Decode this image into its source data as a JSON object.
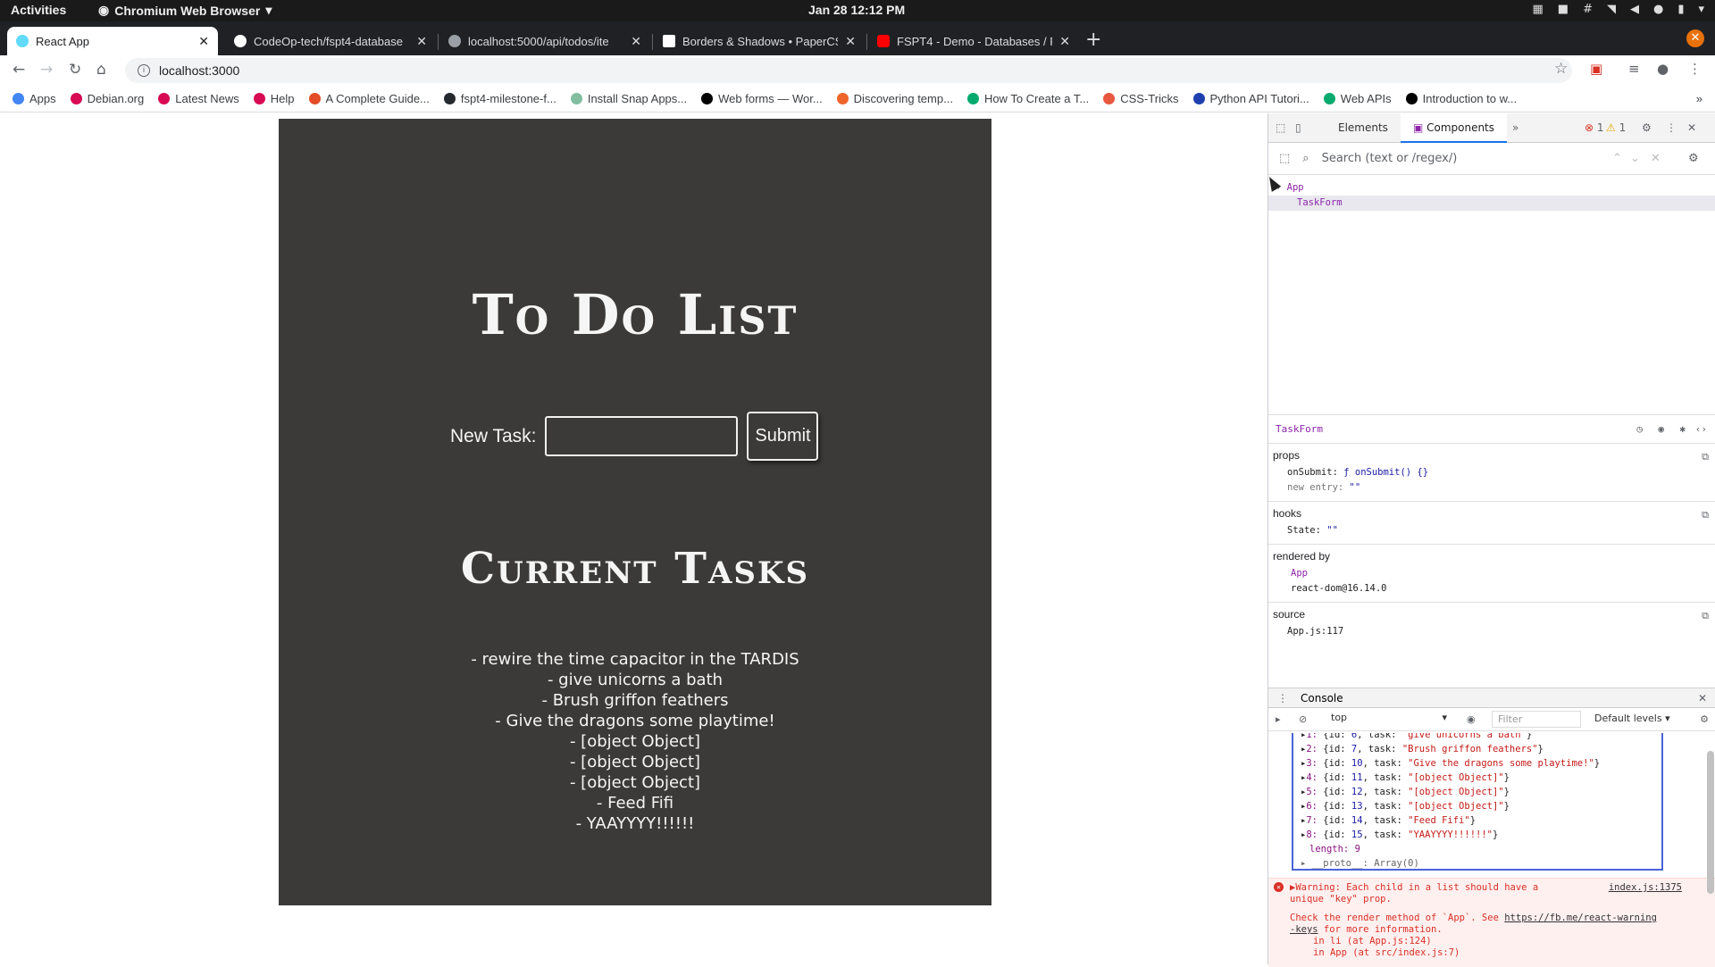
{
  "topbar": {
    "activities": "Activities",
    "app_menu": "Chromium Web Browser",
    "clock": "Jan 28  12:12 PM"
  },
  "tabs": [
    {
      "label": "React App",
      "active": true,
      "icon": "react-icon",
      "color": "#61dafb"
    },
    {
      "label": "CodeOp-tech/fspt4-database",
      "active": false,
      "icon": "github-icon",
      "color": "#ffffff"
    },
    {
      "label": "localhost:5000/api/todos/ite",
      "active": false,
      "icon": "globe-icon",
      "color": "#9aa0a6"
    },
    {
      "label": "Borders & Shadows • PaperCS",
      "active": false,
      "icon": "paper-icon",
      "color": "#ffffff"
    },
    {
      "label": "FSPT4 - Demo - Databases / Fu",
      "active": false,
      "icon": "youtube-icon",
      "color": "#ff0000"
    }
  ],
  "address": {
    "url": "localhost:3000"
  },
  "bookmarks": [
    {
      "label": "Apps",
      "color": "#4285f4"
    },
    {
      "label": "Debian.org",
      "color": "#d70a53"
    },
    {
      "label": "Latest News",
      "color": "#d70a53"
    },
    {
      "label": "Help",
      "color": "#d70a53"
    },
    {
      "label": "A Complete Guide...",
      "color": "#e34c26"
    },
    {
      "label": "fspt4-milestone-f...",
      "color": "#24292e"
    },
    {
      "label": "Install Snap Apps...",
      "color": "#82bea0"
    },
    {
      "label": "Web forms — Wor...",
      "color": "#000000"
    },
    {
      "label": "Discovering temp...",
      "color": "#f06529"
    },
    {
      "label": "How To Create a T...",
      "color": "#04aa6d"
    },
    {
      "label": "CSS-Tricks",
      "color": "#e9573f"
    },
    {
      "label": "Python API Tutori...",
      "color": "#1e40af"
    },
    {
      "label": "Web APIs",
      "color": "#04aa6d"
    },
    {
      "label": "Introduction to w...",
      "color": "#000000"
    }
  ],
  "app": {
    "title": "To Do List",
    "new_task_label": "New Task:",
    "input_value": "",
    "submit_label": "Submit",
    "current_tasks_title": "Current Tasks",
    "tasks": [
      "- rewire the time capacitor in the TARDIS",
      "- give unicorns a bath",
      "- Brush griffon feathers",
      "- Give the dragons some playtime!",
      "- [object Object]",
      "- [object Object]",
      "- [object Object]",
      "- Feed Fifi",
      "- YAAYYYY!!!!!!"
    ],
    "bg_color": "#3b3a38"
  },
  "devtools": {
    "tabs": [
      "Elements",
      "Components"
    ],
    "active_tab": "Components",
    "error_count": "1",
    "warning_count": "1",
    "search_placeholder": "Search (text or /regex/)",
    "tree": [
      "App",
      "TaskForm"
    ],
    "inspector": {
      "component": "TaskForm",
      "props_label": "props",
      "props": [
        {
          "key": "onSubmit:",
          "value": "ƒ onSubmit() {}"
        },
        {
          "key": "new entry:",
          "value": "\"\""
        }
      ],
      "hooks_label": "hooks",
      "hooks": [
        {
          "key": "State:",
          "value": "\"\""
        }
      ],
      "rendered_by_label": "rendered by",
      "rendered_by": [
        "App",
        "react-dom@16.14.0"
      ],
      "source_label": "source",
      "source": "App.js:117"
    },
    "console": {
      "title": "Console",
      "context": "top",
      "filter_placeholder": "Filter",
      "levels": "Default levels ▾",
      "entries": [
        {
          "idx": "1:",
          "id": "6",
          "task": "\"give unicorns a bath\""
        },
        {
          "idx": "2:",
          "id": "7",
          "task": "\"Brush griffon feathers\""
        },
        {
          "idx": "3:",
          "id": "10",
          "task": "\"Give the dragons some playtime!\""
        },
        {
          "idx": "4:",
          "id": "11",
          "task": "\"[object Object]\""
        },
        {
          "idx": "5:",
          "id": "12",
          "task": "\"[object Object]\""
        },
        {
          "idx": "6:",
          "id": "13",
          "task": "\"[object Object]\""
        },
        {
          "idx": "7:",
          "id": "14",
          "task": "\"Feed Fifi\""
        },
        {
          "idx": "8:",
          "id": "15",
          "task": "\"YAAYYYY!!!!!!\""
        }
      ],
      "length_line": "length: 9",
      "proto_line": "__proto__: Array(0)",
      "warning": {
        "message_1": "▶Warning: Each child in a list should have a",
        "message_2": "unique \"key\" prop.",
        "source": "index.js:1375",
        "check_line": "Check the render method of `App`. See",
        "link_1": "https://fb.me/react-warning",
        "link_2": "-keys",
        "link_rest": " for more information.",
        "stack_1": "in li (at App.js:124)",
        "stack_2": "in App (at src/index.js:7)"
      }
    }
  }
}
